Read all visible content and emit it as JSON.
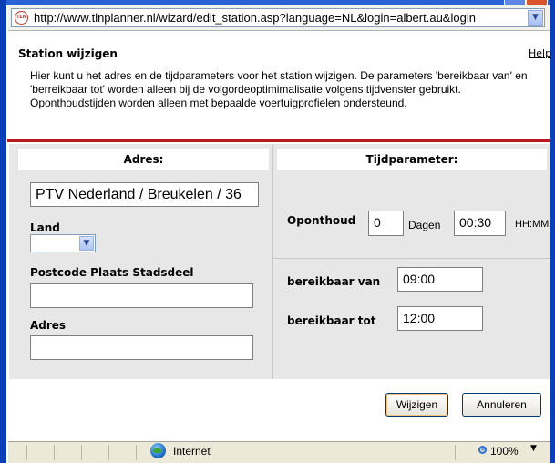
{
  "browser": {
    "url": "http://www.tlnplanner.nl/wizard/edit_station.asp?language=NL&login=albert.au&login",
    "site_icon_text": "TLN",
    "status_zone": "Internet",
    "zoom": "100%"
  },
  "page": {
    "title": "Station wijzigen",
    "help": "Help",
    "intro": "Hier kunt u het adres en de tijdparameters voor het station wijzigen. De parameters 'bereikbaar van' en 'berreikbaar tot' worden alleen bij de volgordeoptimimalisatie volgens tijdvenster gebruikt. Oponthoudstijden worden alleen met bepaalde voertuigprofielen ondersteund."
  },
  "adres": {
    "header": "Adres:",
    "name_value": "PTV Nederland / Breukelen / 36",
    "land_label": "Land",
    "land_value": "",
    "postcode_label": "Postcode Plaats Stadsdeel",
    "postcode_value": "",
    "adres_label": "Adres",
    "adres_value": ""
  },
  "tijd": {
    "header": "Tijdparameter:",
    "oponthoud_label": "Oponthoud",
    "dagen_value": "0",
    "dagen_unit": "Dagen",
    "tijd_value": "00:30",
    "tijd_unit": "HH:MM",
    "van_label": "bereikbaar van",
    "van_value": "09:00",
    "tot_label": "bereikbaar tot",
    "tot_value": "12:00"
  },
  "buttons": {
    "wijzigen": "Wijzigen",
    "annuleren": "Annuleren"
  },
  "colors": {
    "accent_red": "#b8191c",
    "panel_gray": "#e7e7e7",
    "frame_blue": "#0a3fb8"
  }
}
